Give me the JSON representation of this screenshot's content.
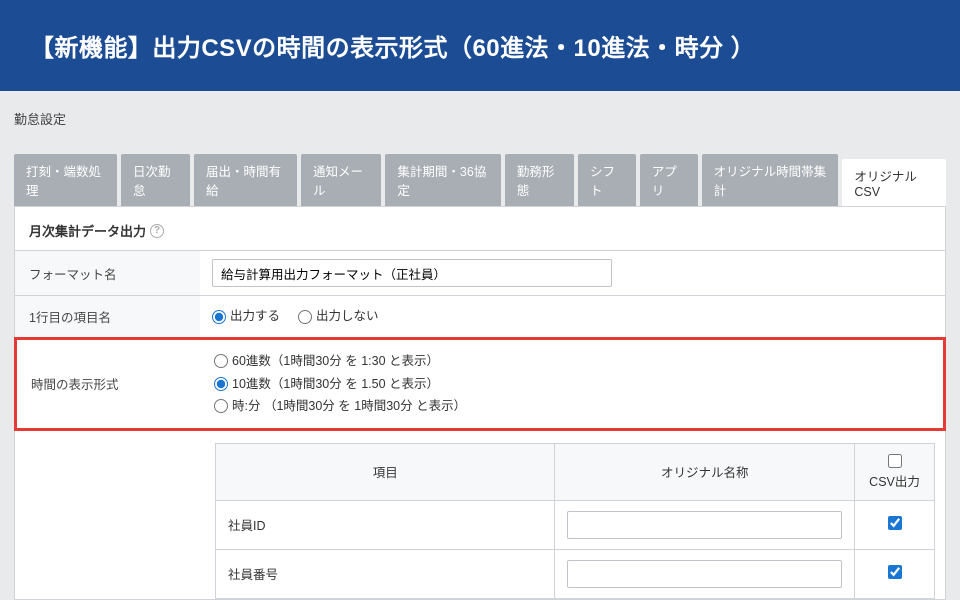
{
  "banner": "【新機能】出力CSVの時間の表示形式（60進法・10進法・時分 ）",
  "pageTitle": "勤怠設定",
  "tabs": [
    "打刻・端数処理",
    "日次勤怠",
    "届出・時間有給",
    "通知メール",
    "集計期間・36協定",
    "勤務形態",
    "シフト",
    "アプリ",
    "オリジナル時間帯集計",
    "オリジナルCSV"
  ],
  "activeTab": 9,
  "section": "月次集計データ出力",
  "fields": {
    "formatName": {
      "label": "フォーマット名",
      "value": "給与計算用出力フォーマット（正社員）"
    },
    "headerRow": {
      "label": "1行目の項目名",
      "options": [
        "出力する",
        "出力しない"
      ],
      "selected": 0
    },
    "timeFormat": {
      "label": "時間の表示形式",
      "options": [
        "60進数（1時間30分 を 1:30 と表示）",
        "10進数（1時間30分 を 1.50 と表示）",
        "時:分 （1時間30分 を 1時間30分 と表示）"
      ],
      "selected": 1
    }
  },
  "table": {
    "headers": {
      "item": "項目",
      "original": "オリジナル名称",
      "csv": "CSV出力"
    },
    "rows": [
      {
        "item": "社員ID",
        "originalName": "",
        "csvOut": true
      },
      {
        "item": "社員番号",
        "originalName": "",
        "csvOut": true
      }
    ],
    "headerCsvChecked": false
  }
}
